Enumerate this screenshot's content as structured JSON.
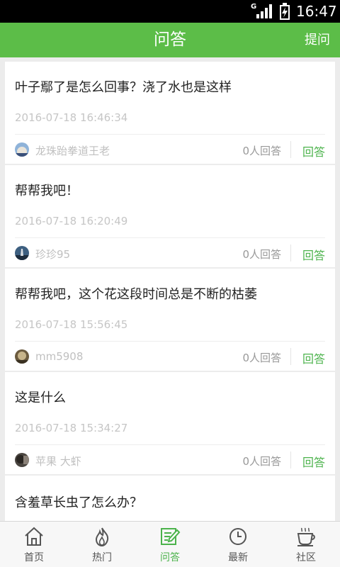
{
  "status_bar": {
    "network": "G",
    "time": "16:47"
  },
  "header": {
    "title": "问答",
    "action": "提问"
  },
  "questions": [
    {
      "question": "叶子鄢了是怎么回事？浇了水也是这样",
      "date": "2016-07-18 16:46:34",
      "user": "龙珠跆拳道王老",
      "answer_count": "0人回答",
      "answer_label": "回答"
    },
    {
      "question": "帮帮我吧！",
      "date": "2016-07-18 16:20:49",
      "user": "珍珍95",
      "answer_count": "0人回答",
      "answer_label": "回答"
    },
    {
      "question": "帮帮我吧，这个花这段时间总是不断的枯萎",
      "date": "2016-07-18 15:56:45",
      "user": "mm5908",
      "answer_count": "0人回答",
      "answer_label": "回答"
    },
    {
      "question": "这是什么",
      "date": "2016-07-18 15:34:27",
      "user": "苹果 大虾",
      "answer_count": "0人回答",
      "answer_label": "回答"
    },
    {
      "question": "含羞草长虫了怎么办？"
    }
  ],
  "tabs": [
    {
      "label": "首页",
      "icon": "home-icon"
    },
    {
      "label": "热门",
      "icon": "flame-icon"
    },
    {
      "label": "问答",
      "icon": "qa-edit-icon",
      "active": true
    },
    {
      "label": "最新",
      "icon": "clock-icon"
    },
    {
      "label": "社区",
      "icon": "coffee-cup-icon"
    }
  ],
  "colors": {
    "brand_green": "#5cbd48",
    "answer_green": "#4cb34c",
    "status_bar": "#000000",
    "background": "#ececec"
  }
}
